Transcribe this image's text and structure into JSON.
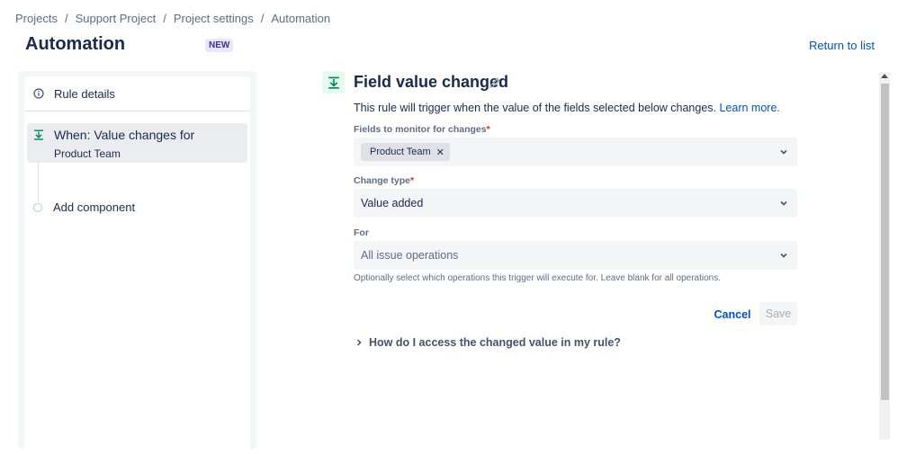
{
  "breadcrumb": [
    "Projects",
    "Support Project",
    "Project settings",
    "Automation"
  ],
  "page": {
    "title": "Automation",
    "badge": "NEW",
    "return_link": "Return to list"
  },
  "sidebar": {
    "rule_details": "Rule details",
    "trigger": {
      "line1": "When: Value changes for",
      "line2": "Product Team"
    },
    "add_component": "Add component"
  },
  "panel": {
    "title": "Field value changed",
    "description": "This rule will trigger when the value of the fields selected below changes.",
    "learn_more": "Learn more.",
    "fields_label": "Fields to monitor for changes",
    "fields_tag": "Product Team",
    "change_type_label": "Change type",
    "change_type_value": "Value added",
    "for_label": "For",
    "for_value": "All issue operations",
    "help_text": "Optionally select which operations this trigger will execute for. Leave blank for all operations.",
    "cancel": "Cancel",
    "save": "Save",
    "expander": "How do I access the changed value in my rule?"
  },
  "colors": {
    "link": "#0052cc",
    "trigger_icon": "#00875a",
    "required": "#de350b",
    "badge_bg": "#eae6ff"
  }
}
